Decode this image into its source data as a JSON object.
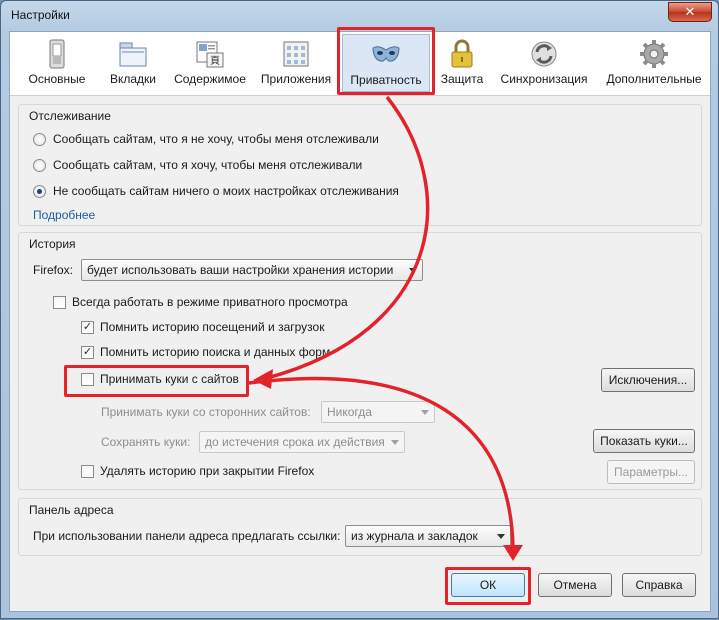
{
  "window": {
    "title": "Настройки",
    "close_label": "✕"
  },
  "toolbar": {
    "items": [
      {
        "label": "Основные",
        "icon": "general-switch-icon"
      },
      {
        "label": "Вкладки",
        "icon": "tabs-icon"
      },
      {
        "label": "Содержимое",
        "icon": "content-icon"
      },
      {
        "label": "Приложения",
        "icon": "applications-icon"
      },
      {
        "label": "Приватность",
        "icon": "mask-icon",
        "selected": true
      },
      {
        "label": "Защита",
        "icon": "padlock-icon"
      },
      {
        "label": "Синхронизация",
        "icon": "sync-icon"
      },
      {
        "label": "Дополнительные",
        "icon": "gear-icon"
      }
    ]
  },
  "tracking": {
    "title": "Отслеживание",
    "options": [
      {
        "label": "Сообщать сайтам, что я не хочу, чтобы меня отслеживали",
        "checked": false
      },
      {
        "label": "Сообщать сайтам, что я хочу, чтобы меня отслеживали",
        "checked": false
      },
      {
        "label": "Не сообщать сайтам ничего о моих настройках отслеживания",
        "checked": true
      }
    ],
    "more_link": "Подробнее"
  },
  "history": {
    "title": "История",
    "firefox_label": "Firefox:",
    "mode_value": "будет использовать ваши настройки хранения истории",
    "private_mode": {
      "label": "Всегда работать в режиме приватного просмотра",
      "checked": false
    },
    "remember_visits": {
      "label": "Помнить историю посещений и загрузок",
      "checked": true
    },
    "remember_search": {
      "label": "Помнить историю поиска и данных форм",
      "checked": true
    },
    "accept_cookies": {
      "label": "Принимать куки с сайтов",
      "checked": false
    },
    "exceptions_button": "Исключения...",
    "third_party_label": "Принимать куки со сторонних сайтов:",
    "third_party_value": "Никогда",
    "keep_label": "Сохранять куки:",
    "keep_value": "до истечения срока их действия",
    "show_cookies_button": "Показать куки...",
    "clear_on_close": {
      "label": "Удалять историю при закрытии Firefox",
      "checked": false
    },
    "settings_button": "Параметры..."
  },
  "address_bar": {
    "title": "Панель адреса",
    "suggest_label": "При использовании панели адреса предлагать ссылки:",
    "suggest_value": "из журнала и закладок"
  },
  "footer": {
    "ok": "ОК",
    "cancel": "Отмена",
    "help": "Справка"
  },
  "colors": {
    "annotation": "#e3232c",
    "selected_tab": "#dbe7f4",
    "link": "#1d5aa6"
  }
}
